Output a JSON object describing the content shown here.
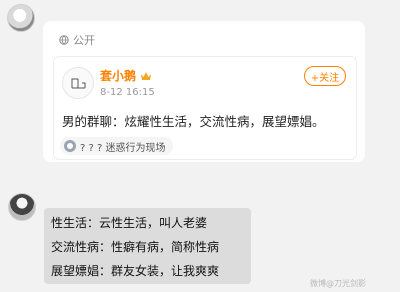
{
  "card": {
    "visibility_label": "公开",
    "post": {
      "author": "套小鹅",
      "time": "8-12 16:15",
      "follow_label": "+关注",
      "text": "男的群聊：炫耀性生活，交流性病，展望嫖娼。",
      "topic_chip": "? ? ? 迷惑行为现场"
    }
  },
  "bubble": {
    "lines": [
      "性生活：云性生活，叫人老婆",
      "交流性病：性癖有病，简称性病",
      "展望嫖娼：群友女装，让我爽爽"
    ]
  },
  "watermark": "微博@刀光剑影"
}
